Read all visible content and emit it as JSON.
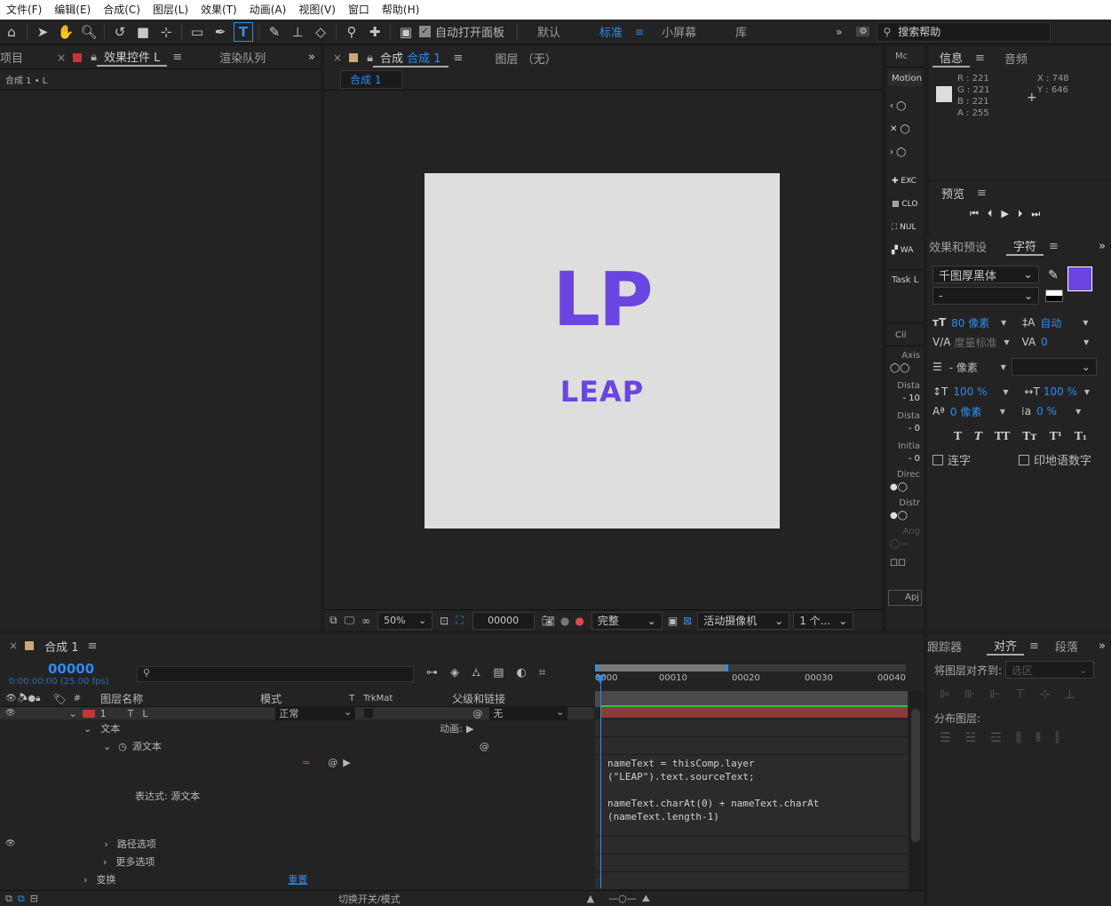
{
  "menu": [
    "文件(F)",
    "编辑(E)",
    "合成(C)",
    "图层(L)",
    "效果(T)",
    "动画(A)",
    "视图(V)",
    "窗口",
    "帮助(H)"
  ],
  "toolbar": {
    "auto_open_label": "自动打开面板",
    "workspaces": [
      "默认",
      "标准",
      "小屏幕",
      "库"
    ],
    "active_workspace": "标准",
    "search_placeholder": "搜索帮助"
  },
  "left_panel": {
    "tabs": [
      "项目",
      "效果控件 L",
      "渲染队列"
    ],
    "breadcrumb": "合成 1 • L"
  },
  "comp_panel": {
    "tab_label": "合成",
    "tab_comp": "合成 1",
    "layer_tab": "图层 （无）",
    "subtab": "合成 1",
    "logo_text": "LP",
    "name_text": "LEAP",
    "canvas_bg": "#dedede",
    "text_color": "#6b45e0",
    "zoom": "50%",
    "timecode": "00000",
    "quality": "完整",
    "camera": "活动摄像机",
    "views": "1 个..."
  },
  "info_panel": {
    "tabs": [
      "信息",
      "音频"
    ],
    "r": "R : 221",
    "g": "G : 221",
    "b": "B : 221",
    "a": "A : 255",
    "x": "X : 748",
    "y": "Y : 646"
  },
  "motion_panel": {
    "tab": "Mc",
    "title": "Motion",
    "items": [
      "EXC",
      "CLO",
      "NUL",
      "WA"
    ],
    "task": "Task L",
    "circle_tab": "Cii",
    "fields": [
      "Axis",
      "Dista",
      "Dista",
      "Initia",
      "Direc",
      "Distr",
      "Ang"
    ],
    "values": [
      "10",
      "0",
      "0"
    ],
    "apply": "Apj"
  },
  "preview_panel": {
    "title": "预览"
  },
  "character_panel": {
    "tabs": [
      "效果和预设",
      "字符"
    ],
    "font": "千图厚黑体",
    "style": "-",
    "size": "80 像素",
    "leading": "自动",
    "kerning": "度量标准",
    "tracking": "0",
    "stroke": "- 像素",
    "vscale": "100 %",
    "hscale": "100 %",
    "baseline": "0 像素",
    "tsume": "0 %",
    "fill_color": "#6b45e0",
    "ligature": "连字",
    "hindi": "印地语数字",
    "format_buttons": [
      "T",
      "T",
      "TT",
      "Tт",
      "T¹",
      "T₁"
    ]
  },
  "align_panel": {
    "tabs": [
      "跟踪器",
      "对齐",
      "段落"
    ],
    "align_to": "将图层对齐到:",
    "align_target": "选区",
    "distribute": "分布图层:"
  },
  "timeline": {
    "tab": "合成 1",
    "timecode": "00000",
    "timecode_sub": "0:00:00:00 (25.00 fps)",
    "columns": {
      "name": "图层名称",
      "mode": "模式",
      "t": "T",
      "trkmat": "TrkMat",
      "parent": "父级和链接"
    },
    "layer": {
      "num": "1",
      "name": "L",
      "mode": "正常",
      "parent": "无"
    },
    "rows": [
      "文本",
      "源文本",
      "路径选项",
      "更多选项",
      "变换"
    ],
    "animate": "动画:",
    "expr_label": "表达式: 源文本",
    "reset": "重置",
    "switch_modes": "切换开关/模式",
    "ruler": [
      "0000",
      "00010",
      "00020",
      "00030",
      "00040"
    ],
    "expression": [
      "nameText = thisComp.layer",
      "(\"LEAP\").text.sourceText;",
      "",
      "nameText.charAt(0) + nameText.charAt",
      "(nameText.length-1)"
    ]
  }
}
